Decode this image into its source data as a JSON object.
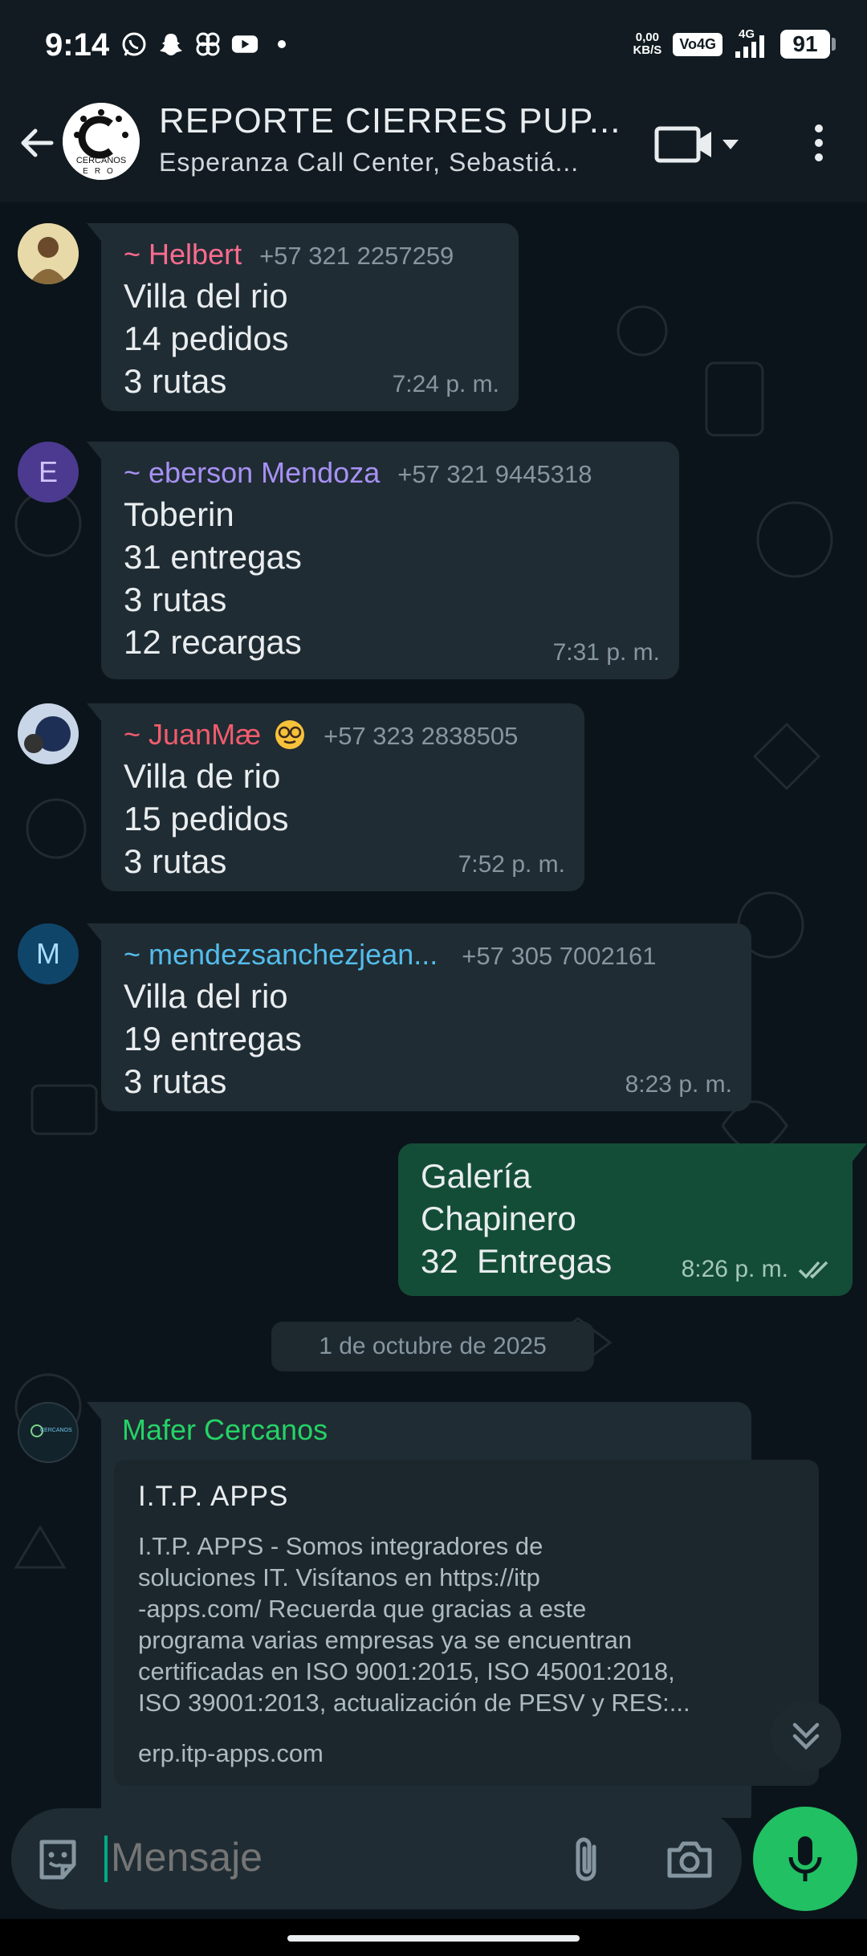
{
  "status_bar": {
    "time": "9:14",
    "icons": [
      "whatsapp-icon",
      "snapchat-icon",
      "pinwheel-icon",
      "youtube-icon",
      "dot-icon"
    ],
    "net_speed_value": "0,00",
    "net_speed_unit": "KB/S",
    "volte": "Vo4G",
    "network": "4G",
    "battery": "91"
  },
  "header": {
    "title": "REPORTE CIERRES PUP...",
    "subtitle": "Esperanza Call Center, Sebastiá...",
    "avatar_text": "CERCANOS",
    "avatar_subtext": "ERO"
  },
  "messages": [
    {
      "sender": "~ Helbert",
      "phone": "+57 321 2257259",
      "lines": [
        "Villa del rio",
        "14 pedidos",
        "3 rutas"
      ],
      "time": "7:24 p. m."
    },
    {
      "sender": "~ eberson Mendoza",
      "avatar_letter": "E",
      "phone": "+57 321 9445318",
      "lines": [
        "Toberin",
        "31 entregas",
        "3 rutas",
        "12 recargas"
      ],
      "time": "7:31 p. m."
    },
    {
      "sender": "~ JuanMæ",
      "phone": "+57 323 2838505",
      "lines": [
        "Villa de rio",
        "15 pedidos",
        "3 rutas"
      ],
      "time": "7:52 p. m."
    },
    {
      "sender": "~ mendezsanchezjean...",
      "avatar_letter": "M",
      "phone": "+57 305 7002161",
      "lines": [
        "Villa del rio",
        "19 entregas",
        "3 rutas"
      ],
      "time": "8:23 p. m."
    }
  ],
  "outgoing": {
    "lines": [
      "Galería",
      "Chapinero",
      "32  Entregas"
    ],
    "time": "8:26 p. m."
  },
  "date_divider": "1 de octubre de 2025",
  "link_message": {
    "sender": "Mafer Cercanos",
    "avatar_text": "CERCANOS",
    "preview_title": "I.T.P. APPS",
    "preview_desc_lines": [
      "I.T.P. APPS - Somos integradores de",
      "soluciones IT. Visítanos en https://itp",
      "-apps.com/ Recuerda que gracias a este",
      "programa varias empresas ya se encuentran",
      "certificadas en ISO 9001:2015, ISO 45001:2018,",
      "ISO 39001:2013, actualización de PESV y RES:..."
    ],
    "preview_link": "erp.itp-apps.com"
  },
  "input": {
    "placeholder": "Mensaje"
  },
  "colors": {
    "background": "#0b141a",
    "header": "#111b21",
    "incoming_bubble": "#202c33",
    "outgoing_bubble": "#144d37",
    "accent_green": "#21c063",
    "sender_helbert": "#fb6b8f",
    "sender_eberson": "#a791f4",
    "sender_juan": "#f15c6d",
    "sender_mendez": "#53bdeb",
    "sender_mafer": "#25d366"
  }
}
